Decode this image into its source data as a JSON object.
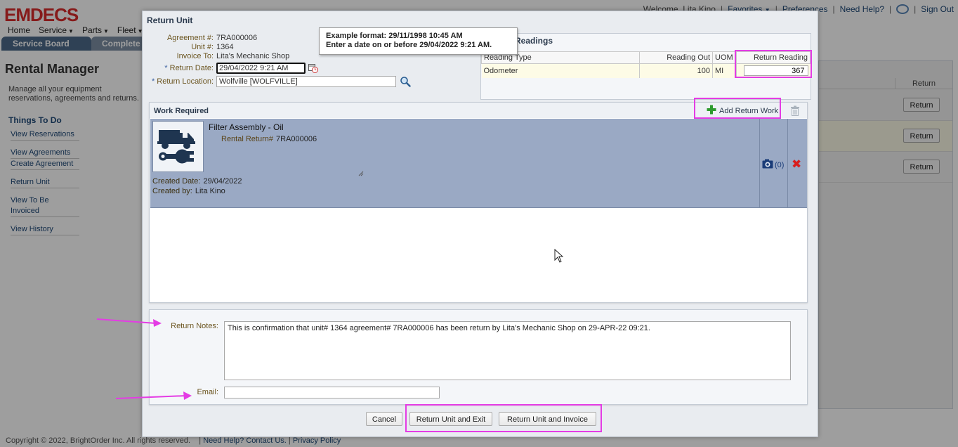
{
  "app": {
    "logo": "EMDECS",
    "topnav": [
      "Home",
      "Service",
      "Parts",
      "Fleet"
    ],
    "tabs": [
      "Service Board",
      "Complete"
    ],
    "header_right": {
      "welcome": "Welcome, Lita Kino",
      "favorites": "Favorites",
      "preferences": "Preferences",
      "need_help": "Need Help?",
      "sign_out": "Sign Out"
    },
    "page_title": "Rental Manager",
    "page_desc": "Manage all your equipment reservations, agreements and returns.",
    "things_to_do": "Things To Do",
    "side_links": [
      [
        "View Reservations"
      ],
      [
        "View Agreements",
        "Create Agreement"
      ],
      [
        "Return Unit"
      ],
      [
        "View To Be Invoiced"
      ],
      [
        "View History"
      ]
    ],
    "right_panel": {
      "column": "Return",
      "buttons": [
        "Return",
        "Return",
        "Return"
      ]
    },
    "footer": {
      "copyright": "Copyright © 2022, BrightOrder Inc. All rights reserved.",
      "help": "Need Help? Contact Us.",
      "privacy": "Privacy Policy"
    }
  },
  "dialog": {
    "title": "Return Unit",
    "fields": {
      "agreement_label": "Agreement #:",
      "agreement_value": "7RA000006",
      "unit_label": "Unit #:",
      "unit_value": "1364",
      "invoice_label": "Invoice To:",
      "invoice_value": "Lita's Mechanic Shop",
      "return_date_label": "Return Date:",
      "return_date_value": "29/04/2022 9:21 AM",
      "return_location_label": "Return Location:",
      "return_location_value": "Wolfville [WOLFVILLE]",
      "required_mark": "*"
    },
    "tooltip": {
      "line1": "Example format: 29/11/1998 10:45 AM",
      "line2": "Enter a date on or before 29/04/2022 9:21 AM."
    },
    "readings": {
      "title": "Readings",
      "columns": [
        "Reading Type",
        "Reading Out",
        "UOM",
        "Return Reading"
      ],
      "rows": [
        {
          "type": "Odometer",
          "out": "100",
          "uom": "MI",
          "return": "367"
        }
      ]
    },
    "work": {
      "title": "Work Required",
      "add_label": "Add Return Work",
      "item": {
        "name": "Filter Assembly - Oil",
        "rental_return_label": "Rental Return#",
        "rental_return_value": "7RA000006",
        "created_date_label": "Created Date:",
        "created_date_value": "29/04/2022",
        "created_by_label": "Created by:",
        "created_by_value": "Lita Kino",
        "photo_count": "(0)"
      }
    },
    "notes": {
      "return_notes_label": "Return Notes:",
      "return_notes_value": "This is confirmation that unit# 1364 agreement# 7RA000006 has been return by Lita's Mechanic Shop on 29-APR-22 09:21.",
      "email_label": "Email:",
      "email_value": ""
    },
    "buttons": {
      "cancel": "Cancel",
      "return_exit": "Return Unit and Exit",
      "return_invoice": "Return Unit and Invoice"
    }
  },
  "colors": {
    "highlight": "#e43ce4",
    "brand_red": "#d92b2b",
    "work_row": "#9aa9c4"
  }
}
